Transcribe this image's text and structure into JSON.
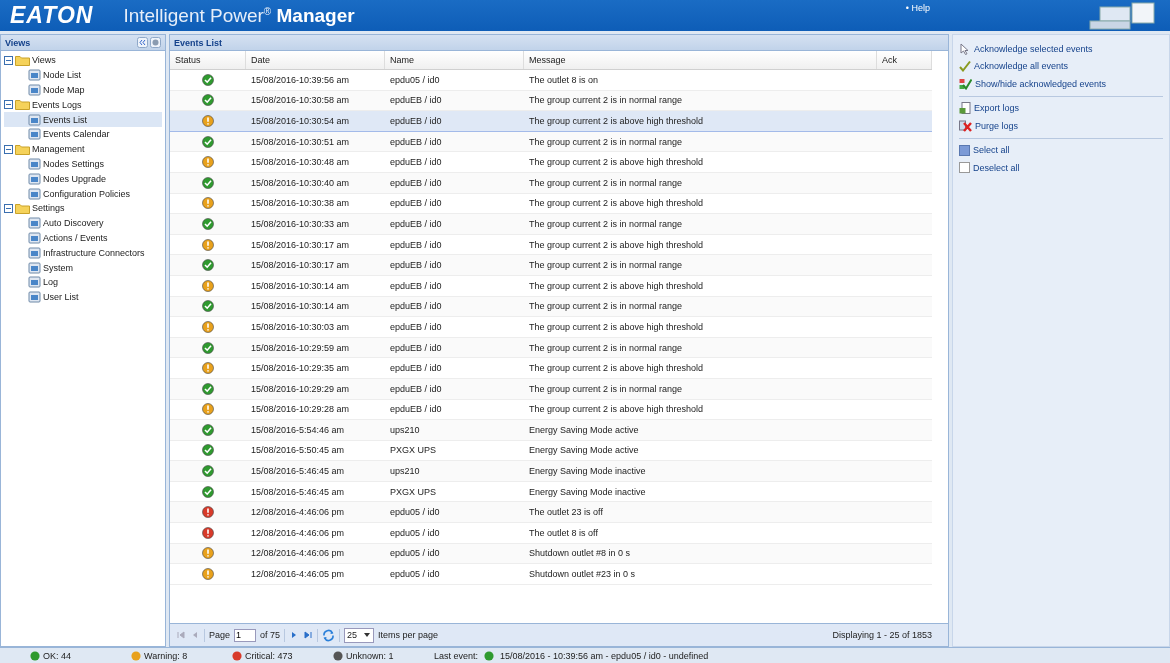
{
  "header": {
    "logo": "EATON",
    "title": "Intelligent Power",
    "title_mark": "®",
    "title_bold": "Manager",
    "help": "• Help"
  },
  "sidebar": {
    "title": "Views",
    "tree": [
      {
        "label": "Views",
        "expanded": true,
        "children": [
          {
            "label": "Node List",
            "selected": false
          },
          {
            "label": "Node Map",
            "selected": false
          }
        ]
      },
      {
        "label": "Events Logs",
        "expanded": true,
        "children": [
          {
            "label": "Events List",
            "selected": true
          },
          {
            "label": "Events Calendar",
            "selected": false
          }
        ]
      },
      {
        "label": "Management",
        "expanded": true,
        "children": [
          {
            "label": "Nodes Settings",
            "selected": false
          },
          {
            "label": "Nodes Upgrade",
            "selected": false
          },
          {
            "label": "Configuration Policies",
            "selected": false
          }
        ]
      },
      {
        "label": "Settings",
        "expanded": true,
        "children": [
          {
            "label": "Auto Discovery",
            "selected": false
          },
          {
            "label": "Actions / Events",
            "selected": false
          },
          {
            "label": "Infrastructure Connectors",
            "selected": false
          },
          {
            "label": "System",
            "selected": false
          },
          {
            "label": "Log",
            "selected": false
          },
          {
            "label": "User List",
            "selected": false
          }
        ]
      }
    ]
  },
  "events": {
    "title": "Events List",
    "columns": [
      "Status",
      "Date",
      "Name",
      "Message",
      "Ack"
    ],
    "rows": [
      {
        "kind": "ok",
        "date": "15/08/2016-10:39:56 am",
        "name": "epdu05 / id0",
        "message": "The outlet 8 is on",
        "selected": false
      },
      {
        "kind": "ok",
        "date": "15/08/2016-10:30:58 am",
        "name": "epduEB / id0",
        "message": "The group current 2 is in normal range",
        "selected": false
      },
      {
        "kind": "warning",
        "date": "15/08/2016-10:30:54 am",
        "name": "epduEB / id0",
        "message": "The group current 2 is above high threshold",
        "selected": true
      },
      {
        "kind": "ok",
        "date": "15/08/2016-10:30:51 am",
        "name": "epduEB / id0",
        "message": "The group current 2 is in normal range",
        "selected": false
      },
      {
        "kind": "warning",
        "date": "15/08/2016-10:30:48 am",
        "name": "epduEB / id0",
        "message": "The group current 2 is above high threshold",
        "selected": false
      },
      {
        "kind": "ok",
        "date": "15/08/2016-10:30:40 am",
        "name": "epduEB / id0",
        "message": "The group current 2 is in normal range",
        "selected": false
      },
      {
        "kind": "warning",
        "date": "15/08/2016-10:30:38 am",
        "name": "epduEB / id0",
        "message": "The group current 2 is above high threshold",
        "selected": false
      },
      {
        "kind": "ok",
        "date": "15/08/2016-10:30:33 am",
        "name": "epduEB / id0",
        "message": "The group current 2 is in normal range",
        "selected": false
      },
      {
        "kind": "warning",
        "date": "15/08/2016-10:30:17 am",
        "name": "epduEB / id0",
        "message": "The group current 2 is above high threshold",
        "selected": false
      },
      {
        "kind": "ok",
        "date": "15/08/2016-10:30:17 am",
        "name": "epduEB / id0",
        "message": "The group current 2 is in normal range",
        "selected": false
      },
      {
        "kind": "warning",
        "date": "15/08/2016-10:30:14 am",
        "name": "epduEB / id0",
        "message": "The group current 2 is above high threshold",
        "selected": false
      },
      {
        "kind": "ok",
        "date": "15/08/2016-10:30:14 am",
        "name": "epduEB / id0",
        "message": "The group current 2 is in normal range",
        "selected": false
      },
      {
        "kind": "warning",
        "date": "15/08/2016-10:30:03 am",
        "name": "epduEB / id0",
        "message": "The group current 2 is above high threshold",
        "selected": false
      },
      {
        "kind": "ok",
        "date": "15/08/2016-10:29:59 am",
        "name": "epduEB / id0",
        "message": "The group current 2 is in normal range",
        "selected": false
      },
      {
        "kind": "warning",
        "date": "15/08/2016-10:29:35 am",
        "name": "epduEB / id0",
        "message": "The group current 2 is above high threshold",
        "selected": false
      },
      {
        "kind": "ok",
        "date": "15/08/2016-10:29:29 am",
        "name": "epduEB / id0",
        "message": "The group current 2 is in normal range",
        "selected": false
      },
      {
        "kind": "warning",
        "date": "15/08/2016-10:29:28 am",
        "name": "epduEB / id0",
        "message": "The group current 2 is above high threshold",
        "selected": false
      },
      {
        "kind": "ok",
        "date": "15/08/2016-5:54:46 am",
        "name": "ups210",
        "message": "Energy Saving Mode active",
        "selected": false
      },
      {
        "kind": "ok",
        "date": "15/08/2016-5:50:45 am",
        "name": "PXGX UPS",
        "message": "Energy Saving Mode active",
        "selected": false
      },
      {
        "kind": "ok",
        "date": "15/08/2016-5:46:45 am",
        "name": "ups210",
        "message": "Energy Saving Mode inactive",
        "selected": false
      },
      {
        "kind": "ok",
        "date": "15/08/2016-5:46:45 am",
        "name": "PXGX UPS",
        "message": "Energy Saving Mode inactive",
        "selected": false
      },
      {
        "kind": "critical",
        "date": "12/08/2016-4:46:06 pm",
        "name": "epdu05 / id0",
        "message": "The outlet 23 is off",
        "selected": false
      },
      {
        "kind": "critical",
        "date": "12/08/2016-4:46:06 pm",
        "name": "epdu05 / id0",
        "message": "The outlet 8 is off",
        "selected": false
      },
      {
        "kind": "warning",
        "date": "12/08/2016-4:46:06 pm",
        "name": "epdu05 / id0",
        "message": "Shutdown outlet #8 in 0 s",
        "selected": false
      },
      {
        "kind": "warning",
        "date": "12/08/2016-4:46:05 pm",
        "name": "epdu05 / id0",
        "message": "Shutdown outlet #23 in 0 s",
        "selected": false
      }
    ]
  },
  "pager": {
    "page_label": "Page",
    "page": "1",
    "of": "of 75",
    "per_page": "25",
    "per_page_label": "Items per page",
    "displaying": "Displaying 1 - 25 of 1853"
  },
  "actions": [
    [
      {
        "kind": "pointer",
        "label": "Acknowledge selected events"
      },
      {
        "kind": "tick",
        "label": "Acknowledge all events"
      },
      {
        "kind": "ticks",
        "label": "Show/hide acknowledged events"
      }
    ],
    [
      {
        "kind": "export",
        "label": "Export logs"
      },
      {
        "kind": "purge",
        "label": "Purge logs"
      }
    ],
    [
      {
        "kind": "select",
        "label": "Select all"
      },
      {
        "kind": "deselect",
        "label": "Deselect all"
      }
    ]
  ],
  "status_bar": {
    "counts": [
      {
        "kind": "ok",
        "label": "OK: 44"
      },
      {
        "kind": "warning",
        "label": "Warning: 8"
      },
      {
        "kind": "critical",
        "label": "Critical: 473"
      },
      {
        "kind": "unknown",
        "label": "Unknown: 1"
      }
    ],
    "last_label": "Last event:",
    "last_event": {
      "kind": "ok",
      "text": "15/08/2016 - 10:39:56 am - epdu05 / id0 - undefined"
    }
  }
}
